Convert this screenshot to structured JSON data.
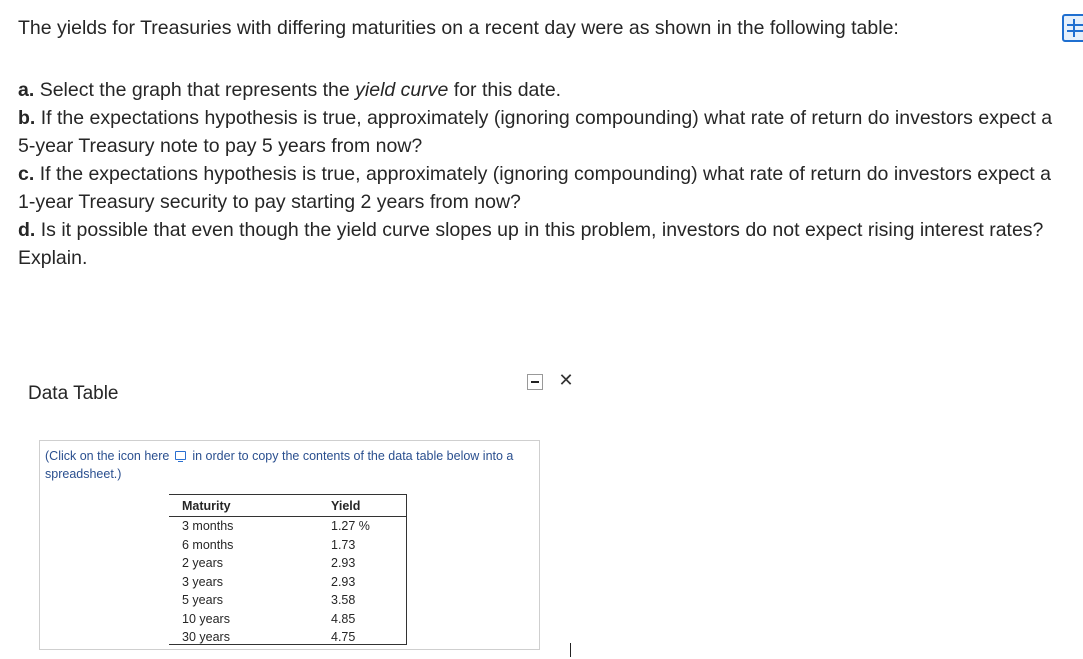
{
  "question": {
    "intro": "The yields for Treasuries with differing maturities on a recent day were as shown in the following table:",
    "parts": [
      {
        "label": "a.",
        "pre": "Select the graph that represents the ",
        "em": "yield curve",
        "post": " for this date."
      },
      {
        "label": "b.",
        "text": "If the expectations hypothesis is true, approximately (ignoring compounding) what rate of return do investors expect a 5-year Treasury note to pay 5 years from now?"
      },
      {
        "label": "c.",
        "text": "If the expectations hypothesis is true, approximately (ignoring compounding) what rate of return do investors expect a 1-year Treasury security to pay starting 2 years from now?"
      },
      {
        "label": "d.",
        "text": "Is it possible that even though the yield curve slopes up in this problem, investors do not expect rising interest rates? Explain."
      }
    ],
    "table_icon": "table-icon"
  },
  "popup": {
    "title": "Data Table",
    "minimize_icon": "minimize-icon",
    "close_icon": "close-icon",
    "close_glyph": "✕",
    "copy_note_pre": "(Click on the icon here",
    "copy_note_post": " in order to copy the contents of the data table below into a spreadsheet.)",
    "copy_icon": "copy-icon",
    "table": {
      "headers": [
        "Maturity",
        "Yield"
      ],
      "rows": [
        [
          "3 months",
          "1.27 %"
        ],
        [
          "6 months",
          "1.73"
        ],
        [
          "2 years",
          "2.93"
        ],
        [
          "3 years",
          "2.93"
        ],
        [
          "5 years",
          "3.58"
        ],
        [
          "10 years",
          "4.85"
        ],
        [
          "30 years",
          "4.75"
        ]
      ]
    }
  },
  "colors": {
    "accent": "#1f6fd0",
    "link_text": "#2a4f8f",
    "body_text": "#262626"
  }
}
